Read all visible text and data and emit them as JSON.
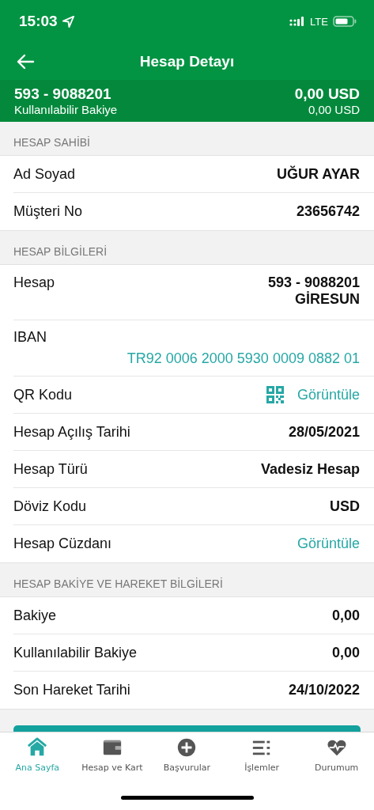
{
  "status_bar": {
    "time": "15:03",
    "network": "LTE"
  },
  "nav": {
    "title": "Hesap Detayı"
  },
  "account_strip": {
    "number": "593 - 9088201",
    "balance": "0,00 USD",
    "available_label": "Kullanılabilir Bakiye",
    "available": "0,00 USD"
  },
  "sections": [
    {
      "title": "HESAP SAHİBİ",
      "rows": [
        {
          "kind": "text",
          "label": "Ad Soyad",
          "values": [
            "UĞUR AYAR"
          ]
        },
        {
          "kind": "text",
          "label": "Müşteri No",
          "values": [
            "23656742"
          ]
        }
      ]
    },
    {
      "title": "HESAP BİLGİLERİ",
      "rows": [
        {
          "kind": "text",
          "label": "Hesap",
          "values": [
            "593 - 9088201",
            "GİRESUN"
          ]
        },
        {
          "kind": "stacked",
          "label": "IBAN",
          "values": [
            "TR92 0006 2000 5930 0009 0882 01"
          ]
        },
        {
          "kind": "qr_link",
          "label": "QR Kodu",
          "values": [
            "Görüntüle"
          ]
        },
        {
          "kind": "text",
          "label": "Hesap Açılış Tarihi",
          "values": [
            "28/05/2021"
          ]
        },
        {
          "kind": "text",
          "label": "Hesap Türü",
          "values": [
            "Vadesiz Hesap"
          ]
        },
        {
          "kind": "text",
          "label": "Döviz Kodu",
          "values": [
            "USD"
          ]
        },
        {
          "kind": "link",
          "label": "Hesap Cüzdanı",
          "values": [
            "Görüntüle"
          ]
        }
      ]
    },
    {
      "title": "HESAP BAKİYE VE HAREKET BİLGİLERİ",
      "rows": [
        {
          "kind": "text",
          "label": "Bakiye",
          "values": [
            "0,00"
          ]
        },
        {
          "kind": "text",
          "label": "Kullanılabilir Bakiye",
          "values": [
            "0,00"
          ]
        },
        {
          "kind": "text",
          "label": "Son Hareket Tarihi",
          "values": [
            "24/10/2022"
          ]
        }
      ]
    }
  ],
  "tab_bar": [
    {
      "kind": "home",
      "label": "Ana Sayfa",
      "selected": true
    },
    {
      "kind": "wallet",
      "label": "Hesap ve Kart",
      "selected": false
    },
    {
      "kind": "plus",
      "label": "Başvurular",
      "selected": false
    },
    {
      "kind": "list",
      "label": "İşlemler",
      "selected": false
    },
    {
      "kind": "heart",
      "label": "Durumum",
      "selected": false
    }
  ]
}
